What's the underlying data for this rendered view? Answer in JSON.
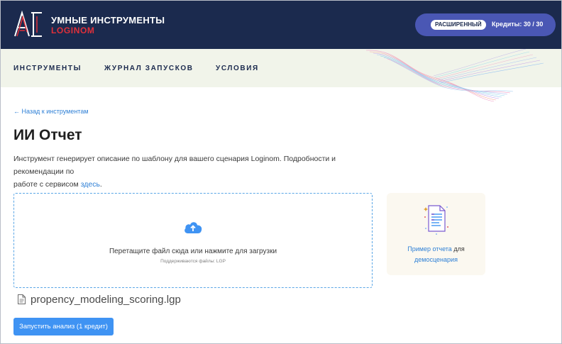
{
  "header": {
    "brand_title": "УМНЫЕ ИНСТРУМЕНТЫ",
    "brand_sub": "LOGINOM",
    "plan_badge": "РАСШИРЕННЫЙ",
    "credits_text": "Кредиты:  30 / 30",
    "colors": {
      "bar": "#1b2a4e",
      "accent": "#e0303a",
      "pill": "#4a57b4"
    }
  },
  "nav": {
    "items": [
      {
        "label": "ИНСТРУМЕНТЫ"
      },
      {
        "label": "ЖУРНАЛ ЗАПУСКОВ"
      },
      {
        "label": "УСЛОВИЯ"
      }
    ]
  },
  "main": {
    "back_link": "← Назад к инструментам",
    "title": "ИИ Отчет",
    "description_line1": "Инструмент генерирует описание по шаблону для вашего сценария Loginom. Подробности и рекомендации по",
    "description_line2_prefix": "работе с сервисом ",
    "description_link": "здесь",
    "description_suffix": ".",
    "dropzone": {
      "icon": "cloud-upload-icon",
      "text": "Перетащите файл сюда или нажмите для загрузки",
      "hint": "Поддерживаются файлы: LGP"
    },
    "side_card": {
      "icon": "report-document-icon",
      "link1": "Пример отчета",
      "text1": " для",
      "link2": "демосценария"
    },
    "file": {
      "icon": "file-icon",
      "name": "propency_modeling_scoring.lgp"
    },
    "run_button": "Запустить анализ (1 кредит)",
    "colors": {
      "link": "#2f80d6",
      "button": "#3f93f3"
    }
  }
}
